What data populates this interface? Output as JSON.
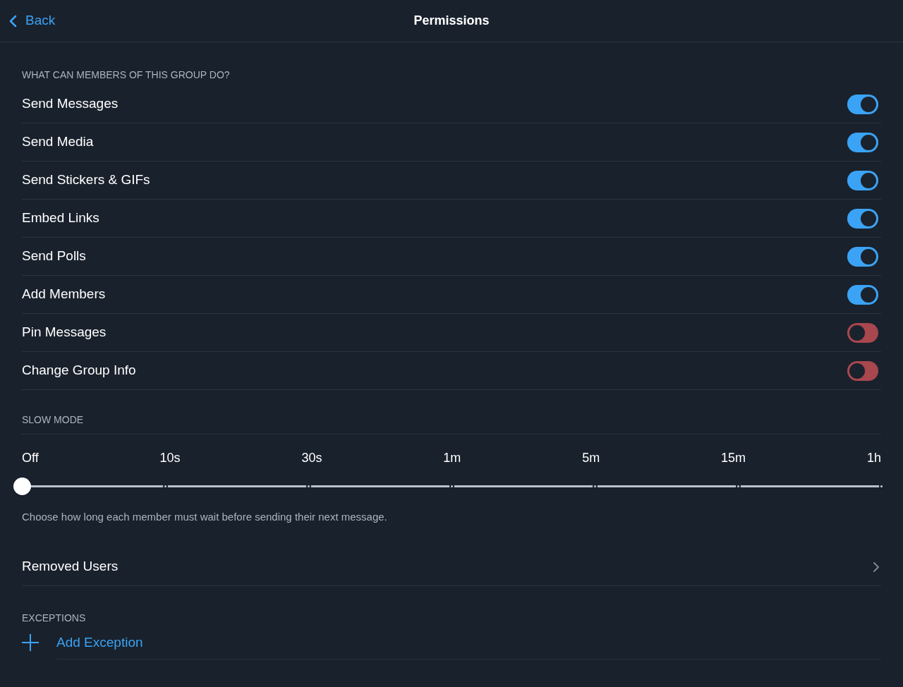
{
  "nav": {
    "back": "Back",
    "title": "Permissions"
  },
  "permissions": {
    "header": "WHAT CAN MEMBERS OF THIS GROUP DO?",
    "items": [
      {
        "label": "Send Messages",
        "on": true
      },
      {
        "label": "Send Media",
        "on": true
      },
      {
        "label": "Send Stickers & GIFs",
        "on": true
      },
      {
        "label": "Embed Links",
        "on": true
      },
      {
        "label": "Send Polls",
        "on": true
      },
      {
        "label": "Add Members",
        "on": true
      },
      {
        "label": "Pin Messages",
        "on": false
      },
      {
        "label": "Change Group Info",
        "on": false
      }
    ]
  },
  "slow_mode": {
    "header": "SLOW MODE",
    "level": 0,
    "options": [
      "Off",
      "10s",
      "30s",
      "1m",
      "5m",
      "15m",
      "1h"
    ],
    "hint": "Choose how long each member must wait before sending their next message."
  },
  "removed_users": {
    "label": "Removed Users"
  },
  "exceptions": {
    "header": "EXCEPTIONS",
    "add": "Add Exception"
  }
}
